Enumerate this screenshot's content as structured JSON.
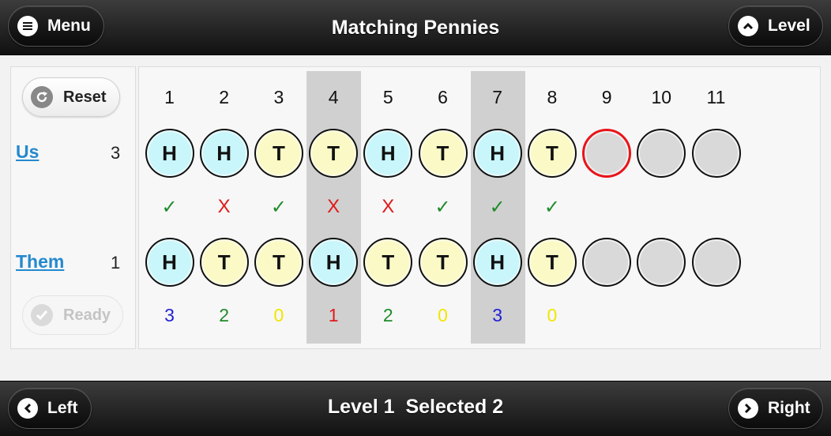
{
  "header": {
    "title": "Matching Pennies",
    "menu_label": "Menu",
    "level_label": "Level"
  },
  "footer": {
    "status": "Level 1  Selected 2",
    "left_label": "Left",
    "right_label": "Right"
  },
  "controls": {
    "reset_label": "Reset",
    "ready_label": "Ready"
  },
  "players": {
    "us": {
      "name": "Us",
      "score": "3"
    },
    "them": {
      "name": "Them",
      "score": "1"
    }
  },
  "columns": [
    "1",
    "2",
    "3",
    "4",
    "5",
    "6",
    "7",
    "8",
    "9",
    "10",
    "11"
  ],
  "highlighted_columns": [
    4,
    7
  ],
  "current_column": 9,
  "us_coins": [
    "H",
    "H",
    "T",
    "T",
    "H",
    "T",
    "H",
    "T",
    "",
    "",
    ""
  ],
  "them_coins": [
    "H",
    "T",
    "T",
    "H",
    "T",
    "T",
    "H",
    "T",
    "",
    "",
    ""
  ],
  "results": [
    "check",
    "cross",
    "check",
    "cross",
    "cross",
    "check",
    "check",
    "check",
    "",
    "",
    ""
  ],
  "result_symbols": {
    "check": "✓",
    "cross": "X"
  },
  "counts": [
    "3",
    "2",
    "0",
    "1",
    "2",
    "0",
    "3",
    "0",
    "",
    "",
    ""
  ],
  "count_colors": [
    "#1f1fd6",
    "#1e8b2a",
    "#f2e600",
    "#e11919",
    "#1e8b2a",
    "#f2e600",
    "#1f1fd6",
    "#f2e600",
    "",
    "",
    ""
  ],
  "colors": {
    "heads": "#c8f6fb",
    "tails": "#fbfac6",
    "empty": "#d9d9d9",
    "link": "#2489ce",
    "current_border": "#e8141a"
  }
}
